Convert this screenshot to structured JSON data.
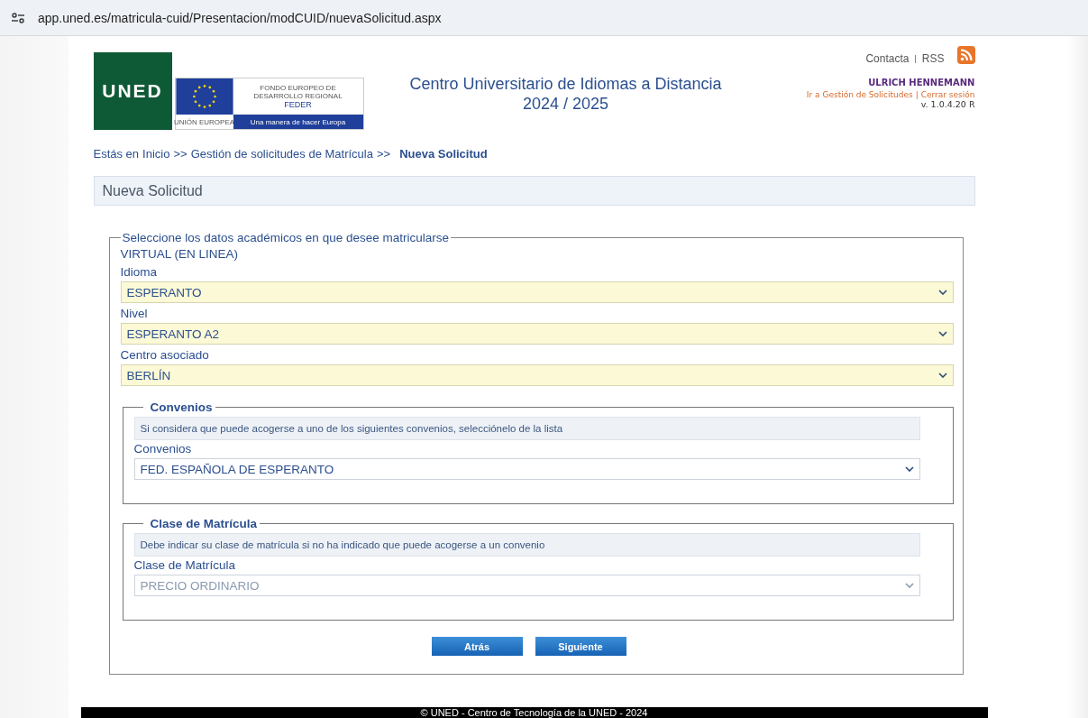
{
  "browser": {
    "url": "app.uned.es/matricula-cuid/Presentacion/modCUID/nuevaSolicitud.aspx"
  },
  "header": {
    "logo_text": "UNED",
    "feder_logo": {
      "top_text": "FONDO EUROPEO DE DESARROLLO REGIONAL",
      "name": "FEDER",
      "left_caption": "UNIÓN EUROPEA",
      "right_caption": "Una manera de hacer Europa"
    },
    "title": "Centro Universitario de Idiomas a Distancia",
    "year": "2024 / 2025",
    "top_links": [
      "Contacta",
      "RSS"
    ],
    "top_separator": "|",
    "user": "ULRICH HENNEMANN",
    "user_links": [
      "Ir a Gestión de Solicitudes",
      "Cerrar sesión"
    ],
    "user_separator": "|",
    "version": "v. 1.0.4.20 R"
  },
  "breadcrumb": {
    "prefix": "Estás en",
    "links": [
      "Inicio",
      "Gestión de solicitudes de Matrícula"
    ],
    "separator": ">>",
    "current": "Nueva Solicitud"
  },
  "page_title": "Nueva Solicitud",
  "form": {
    "legend": "Seleccione los datos académicos en que desee matricularse",
    "modality": "VIRTUAL (EN LINEA)",
    "fields": [
      {
        "label": "Idioma",
        "value": "ESPERANTO",
        "highlighted": true,
        "disabled": false
      },
      {
        "label": "Nivel",
        "value": "ESPERANTO A2",
        "highlighted": true,
        "disabled": false
      },
      {
        "label": "Centro asociado",
        "value": "BERLÍN",
        "highlighted": true,
        "disabled": false
      }
    ]
  },
  "sections": [
    {
      "legend": "Convenios",
      "note": "Si considera que puede acogerse a uno de los siguientes convenios, selecciónelo de la lista",
      "field": {
        "label": "Convenios",
        "value": "FED. ESPAÑOLA DE ESPERANTO",
        "highlighted": false,
        "disabled": false
      }
    },
    {
      "legend": "Clase de Matrícula",
      "note": "Debe indicar su clase de matrícula si no ha indicado que puede acogerse a un convenio",
      "field": {
        "label": "Clase de Matrícula",
        "value": "PRECIO ORDINARIO",
        "highlighted": false,
        "disabled": true
      }
    }
  ],
  "buttons": [
    "Atrás",
    "Siguiente"
  ],
  "footer": "© UNED - Centro de Tecnología de la UNED - 2024"
}
